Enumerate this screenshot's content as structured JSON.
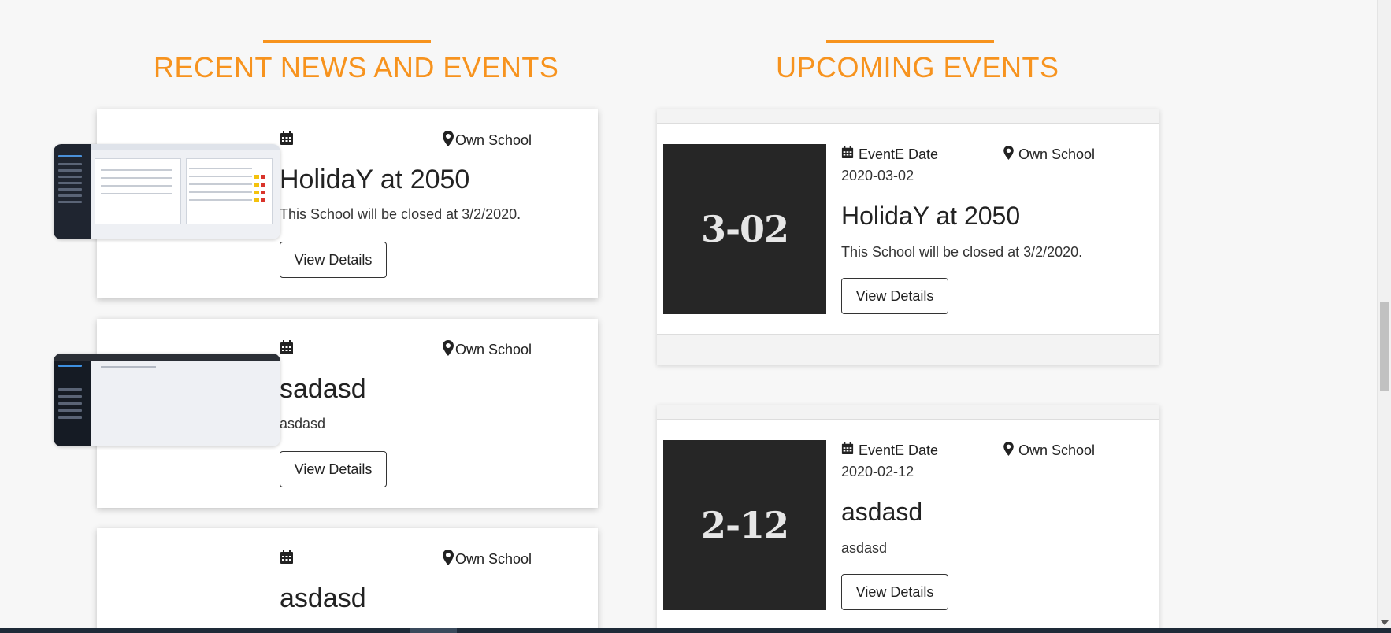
{
  "sections": {
    "recent_title": "RECENT NEWS AND EVENTS",
    "upcoming_title": "UPCOMING EVENTS"
  },
  "colors": {
    "accent": "#f7931e",
    "date_box": "#262626"
  },
  "news": [
    {
      "location": "Own School",
      "title": "HolidaY at 2050",
      "text": "This School will be closed at 3/2/2020.",
      "button": "View Details"
    },
    {
      "location": "Own School",
      "title": "sadasd",
      "text": "asdasd",
      "button": "View Details"
    },
    {
      "location": "Own School",
      "title": "asdasd",
      "text": "",
      "button": ""
    }
  ],
  "events": [
    {
      "badge": "3-02",
      "date_label": "EventE Date",
      "date": "2020-03-02",
      "location": "Own School",
      "title": "HolidaY at 2050",
      "text": "This School will be closed at 3/2/2020.",
      "button": "View Details"
    },
    {
      "badge": "2-12",
      "date_label": "EventE Date",
      "date": "2020-02-12",
      "location": "Own School",
      "title": "asdasd",
      "text": "asdasd",
      "button": "View Details"
    }
  ]
}
